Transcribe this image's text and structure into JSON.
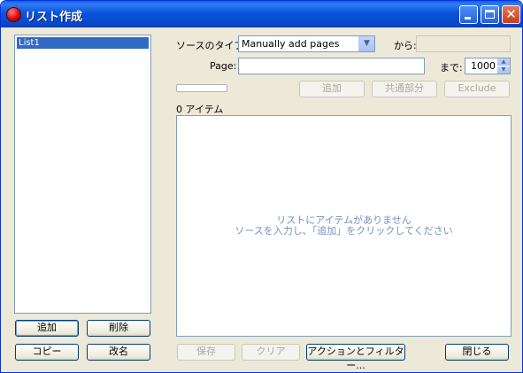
{
  "window": {
    "title": "リスト作成"
  },
  "list": {
    "items": [
      "List1"
    ]
  },
  "left_buttons": {
    "add": "追加",
    "delete": "削除",
    "copy": "コピー",
    "rename": "改名"
  },
  "source": {
    "type_label": "ソースのタイプ:",
    "type_value": "Manually add pages",
    "from_label": "から:",
    "from_value": "",
    "page_label": "Page:",
    "page_value": "",
    "to_label": "まで:",
    "to_value": "1000"
  },
  "action_buttons": {
    "add": "追加",
    "common": "共通部分",
    "exclude": "Exclude"
  },
  "items": {
    "count_label": "0 アイテム",
    "empty_line1": "リストにアイテムがありません",
    "empty_line2": "ソースを入力し、「追加」をクリックしてください"
  },
  "bottom_buttons": {
    "save": "保存",
    "clear": "クリア",
    "actions": "アクションとフィルター...",
    "close": "閉じる"
  }
}
